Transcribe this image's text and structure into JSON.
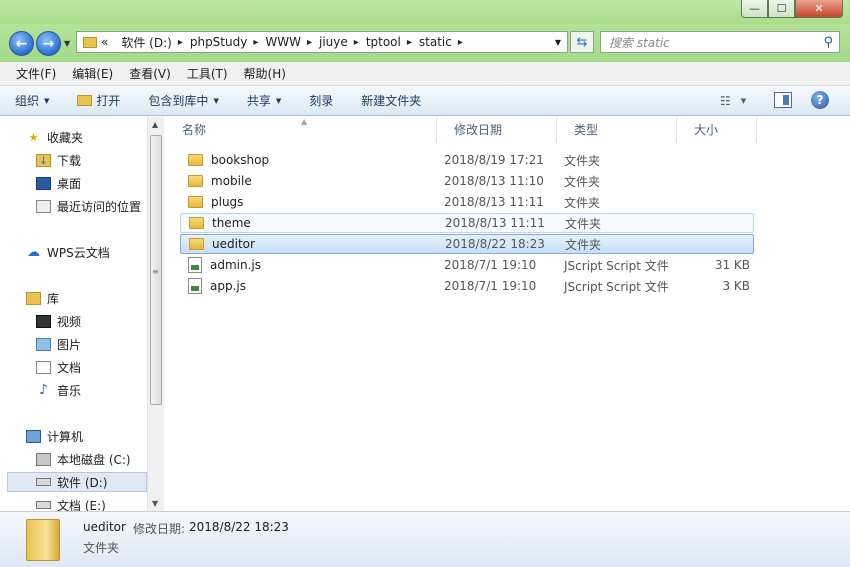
{
  "window": {
    "minimize_glyph": "—",
    "maximize_glyph": "☐",
    "close_glyph": "✕"
  },
  "address": {
    "overflow": "«",
    "crumbs": [
      "软件 (D:)",
      "phpStudy",
      "WWW",
      "jiuye",
      "tptool",
      "static"
    ],
    "separator": "▸"
  },
  "search": {
    "placeholder": "搜索 static"
  },
  "menu": [
    "文件(F)",
    "编辑(E)",
    "查看(V)",
    "工具(T)",
    "帮助(H)"
  ],
  "commands": {
    "organize": "组织",
    "open": "打开",
    "include": "包含到库中",
    "share": "共享",
    "burn": "刻录",
    "new_folder": "新建文件夹"
  },
  "nav": {
    "favorites": "收藏夹",
    "downloads": "下载",
    "desktop": "桌面",
    "recent": "最近访问的位置",
    "wps": "WPS云文档",
    "libraries": "库",
    "videos": "视频",
    "pictures": "图片",
    "documents": "文档",
    "music": "音乐",
    "computer": "计算机",
    "drive_c": "本地磁盘 (C:)",
    "drive_d": "软件 (D:)",
    "drive_e": "文档 (E:)"
  },
  "columns": {
    "name": "名称",
    "modified": "修改日期",
    "type": "类型",
    "size": "大小"
  },
  "files": [
    {
      "name": "bookshop",
      "modified": "2018/8/19 17:21",
      "type": "文件夹",
      "size": "",
      "kind": "folder"
    },
    {
      "name": "mobile",
      "modified": "2018/8/13 11:10",
      "type": "文件夹",
      "size": "",
      "kind": "folder"
    },
    {
      "name": "plugs",
      "modified": "2018/8/13 11:11",
      "type": "文件夹",
      "size": "",
      "kind": "folder"
    },
    {
      "name": "theme",
      "modified": "2018/8/13 11:11",
      "type": "文件夹",
      "size": "",
      "kind": "folder"
    },
    {
      "name": "ueditor",
      "modified": "2018/8/22 18:23",
      "type": "文件夹",
      "size": "",
      "kind": "folder"
    },
    {
      "name": "admin.js",
      "modified": "2018/7/1 19:10",
      "type": "JScript Script 文件",
      "size": "31 KB",
      "kind": "js"
    },
    {
      "name": "app.js",
      "modified": "2018/7/1 19:10",
      "type": "JScript Script 文件",
      "size": "3 KB",
      "kind": "js"
    }
  ],
  "details": {
    "name": "ueditor",
    "modified_label": "修改日期:",
    "modified_value": "2018/8/22 18:23",
    "type": "文件夹"
  }
}
